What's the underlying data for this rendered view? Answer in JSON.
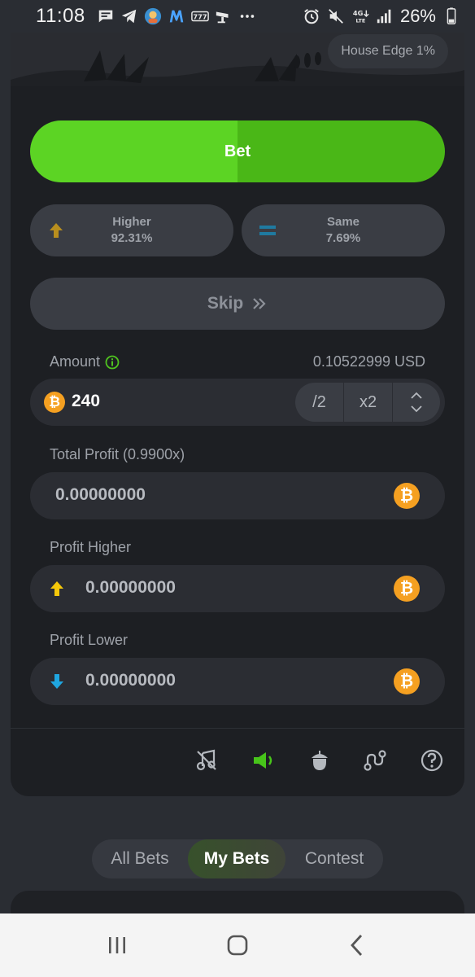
{
  "status_bar": {
    "time": "11:08",
    "battery": "26%",
    "network": "4G LTE",
    "icons_left": [
      "chat-icon",
      "telegram-icon",
      "app-avatar-icon",
      "m-app-icon",
      "slots-icon",
      "cctv-icon",
      "more-dots"
    ],
    "icons_right": [
      "alarm-icon",
      "mute-icon",
      "lte-icon",
      "signal-icon",
      "battery-icon"
    ]
  },
  "game": {
    "house_edge": "House Edge 1%",
    "bet_label": "Bet",
    "higher": {
      "title": "Higher",
      "pct": "92.31%"
    },
    "same": {
      "title": "Same",
      "pct": "7.69%"
    },
    "skip_label": "Skip",
    "amount": {
      "label": "Amount",
      "usd": "0.10522999 USD",
      "value": "240",
      "half": "/2",
      "double": "x2"
    },
    "total_profit": {
      "label": "Total Profit (0.9900x)",
      "value": "0.00000000"
    },
    "profit_higher": {
      "label": "Profit Higher",
      "value": "0.00000000"
    },
    "profit_lower": {
      "label": "Profit Lower",
      "value": "0.00000000"
    },
    "currency_symbol": "₿"
  },
  "toolbar": [
    "music-off-icon",
    "sound-icon",
    "acorn-icon",
    "route-icon",
    "help-icon"
  ],
  "tabs": {
    "all": "All Bets",
    "my": "My Bets",
    "contest": "Contest"
  },
  "colors": {
    "accent_green": "#5cd424",
    "coin_orange": "#f5a021",
    "higher_up": "#b88e1e",
    "same_equal": "#1f7aa0",
    "arrow_yellow": "#f5c80a",
    "arrow_blue": "#1fa6e0"
  }
}
